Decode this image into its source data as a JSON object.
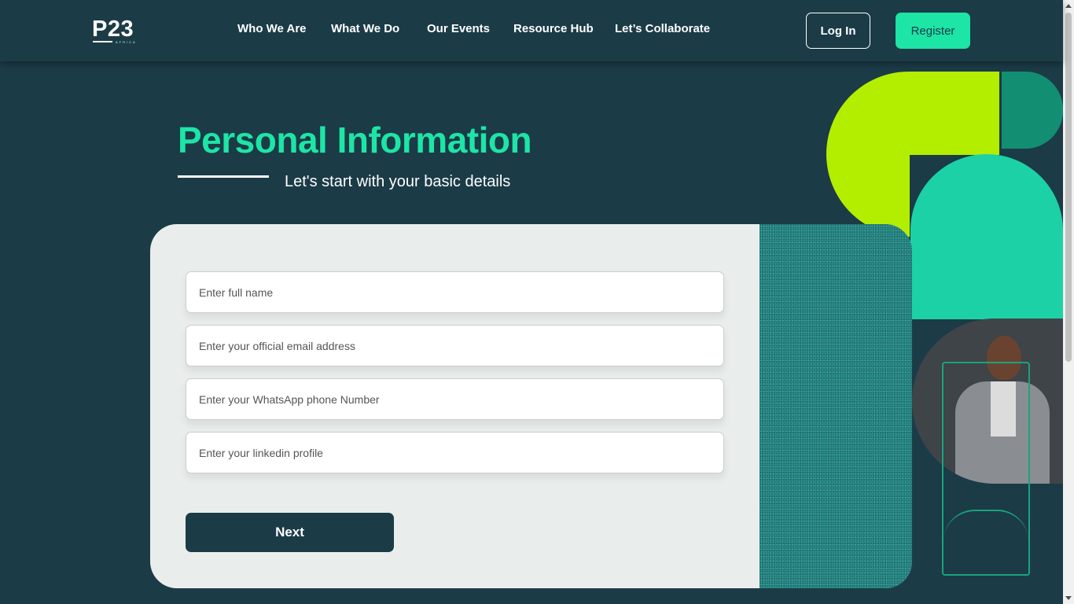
{
  "header": {
    "logo": {
      "text": "P23",
      "subtext": "AFRICA"
    },
    "nav": [
      {
        "label": "Who We Are"
      },
      {
        "label": "What We Do"
      },
      {
        "label": "Our Events"
      },
      {
        "label": "Resource Hub"
      },
      {
        "label": "Let’s Collaborate"
      }
    ],
    "login_label": "Log In",
    "register_label": "Register"
  },
  "main": {
    "title": "Personal Information",
    "subtitle": "Let's start with your basic details"
  },
  "form": {
    "fields": [
      {
        "placeholder": "Enter full name"
      },
      {
        "placeholder": "Enter your official email address"
      },
      {
        "placeholder": "Enter your WhatsApp phone Number"
      },
      {
        "placeholder": "Enter your linkedin profile"
      }
    ],
    "next_label": "Next"
  },
  "colors": {
    "background": "#1b3b47",
    "accent": "#1de5a6",
    "lime": "#b3ee00",
    "card": "#e9eeec"
  }
}
